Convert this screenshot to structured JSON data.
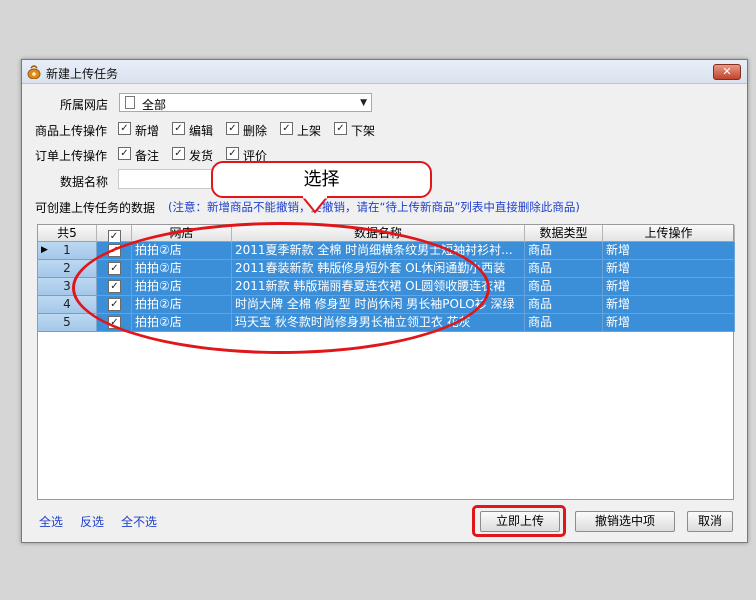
{
  "window": {
    "title": "新建上传任务",
    "close_label": "✕"
  },
  "form": {
    "shop_label": "所属网店",
    "shop_value": "全部",
    "goods_op_label": "商品上传操作",
    "goods_ops": [
      {
        "label": "新增",
        "checked": true
      },
      {
        "label": "编辑",
        "checked": true
      },
      {
        "label": "删除",
        "checked": true
      },
      {
        "label": "上架",
        "checked": true
      },
      {
        "label": "下架",
        "checked": true
      }
    ],
    "order_op_label": "订单上传操作",
    "order_ops": [
      {
        "label": "备注",
        "checked": true
      },
      {
        "label": "发货",
        "checked": true
      },
      {
        "label": "评价",
        "checked": true
      }
    ],
    "data_name_label": "数据名称",
    "data_name_value": "",
    "list_label": "可创建上传任务的数据",
    "note": "(注意：新增商品不能撤销，要撤销，请在“待上传新商品”列表中直接删除此商品)"
  },
  "grid": {
    "headers": {
      "count": "共5",
      "shop": "网店",
      "name": "数据名称",
      "type": "数据类型",
      "op": "上传操作"
    },
    "rows": [
      {
        "no": "1",
        "shop": "拍拍②店",
        "name": "2011夏季新款 全棉 时尚细横条纹男士短袖衬衫衬...",
        "type": "商品",
        "op": "新增"
      },
      {
        "no": "2",
        "shop": "拍拍②店",
        "name": "2011春装新款 韩版修身短外套 OL休闲通勤小西装",
        "type": "商品",
        "op": "新增"
      },
      {
        "no": "3",
        "shop": "拍拍②店",
        "name": "2011新款 韩版瑞丽春夏连衣裙 OL圆领收腰连衣裙",
        "type": "商品",
        "op": "新增"
      },
      {
        "no": "4",
        "shop": "拍拍②店",
        "name": "时尚大牌 全棉 修身型 时尚休闲 男长袖POLO衫 深绿",
        "type": "商品",
        "op": "新增"
      },
      {
        "no": "5",
        "shop": "拍拍②店",
        "name": "玛天宝 秋冬款时尚修身男长袖立领卫衣 花灰",
        "type": "商品",
        "op": "新增"
      }
    ]
  },
  "footer": {
    "select_all": "全选",
    "invert": "反选",
    "select_none": "全不选",
    "upload_now": "立即上传",
    "undo_selected": "撤销选中项",
    "cancel": "取消"
  },
  "annotation": {
    "callout": "选择"
  },
  "colors": {
    "selection": "#3b8fd9",
    "highlight": "#e0161a",
    "link": "#1e3fcc"
  }
}
